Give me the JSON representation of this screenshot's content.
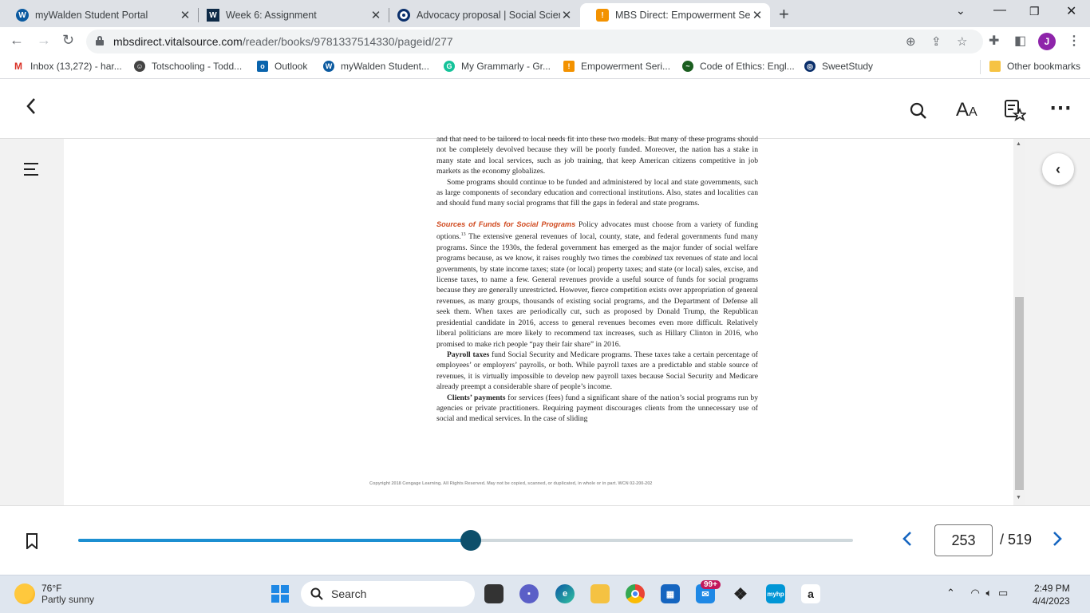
{
  "browser": {
    "tabs": [
      {
        "title": "myWalden Student Portal",
        "icon": "walden-icon",
        "active": false
      },
      {
        "title": "Week 6: Assignment",
        "icon": "walden-w-icon",
        "active": false
      },
      {
        "title": "Advocacy proposal | Social Scienc",
        "icon": "sweetstudy-icon",
        "active": false
      },
      {
        "title": "MBS Direct: Empowerment Series",
        "icon": "mbs-icon",
        "active": true
      }
    ],
    "url_domain": "mbsdirect.vitalsource.com",
    "url_path": "/reader/books/9781337514330/pageid/277",
    "profile_initial": "J",
    "bookmarks": [
      {
        "label": "Inbox (13,272) - har...",
        "icon": "gmail-icon"
      },
      {
        "label": "Totschooling - Todd...",
        "icon": "totschooling-icon"
      },
      {
        "label": "Outlook",
        "icon": "outlook-icon"
      },
      {
        "label": "myWalden Student...",
        "icon": "walden-icon"
      },
      {
        "label": "My Grammarly - Gr...",
        "icon": "grammarly-icon"
      },
      {
        "label": "Empowerment Seri...",
        "icon": "mbs-icon"
      },
      {
        "label": "Code of Ethics: Engl...",
        "icon": "nasw-icon"
      },
      {
        "label": "SweetStudy",
        "icon": "sweetstudy-icon"
      }
    ],
    "other_bookmarks": "Other bookmarks"
  },
  "book": {
    "para1": "and that need to be tailored to local needs fit into these two models. But many of these programs should not be completely devolved because they will be poorly funded. Moreover, the nation has a stake in many state and local services, such as job training, that keep American citizens competitive in job markets as the economy globalizes.",
    "para2": "Some programs should continue to be funded and administered by local and state governments, such as large components of secondary education and correctional institutions. Also, states and localities can and should fund many social programs that fill the gaps in federal and state programs.",
    "section_heading": "Sources of Funds for Social Programs",
    "para3_a": " Policy advocates must choose from a variety of funding options.",
    "para3_footnote": "13",
    "para3_b": " The extensive general revenues of local, county, state, and federal governments fund many programs. Since the 1930s, the federal government has emerged as the major funder of social welfare programs because, as we know, it raises roughly two times the ",
    "para3_emph": "combined",
    "para3_c": " tax revenues of state and local governments, by state income taxes; state (or local) property taxes; and state (or local) sales, excise, and license taxes, to name a few. General revenues provide a useful source of funds for social programs because they are generally unrestricted. However, fierce competition exists over appropriation of general revenues, as many groups, thousands of existing social programs, and the Department of Defense all seek them. When taxes are periodically cut, such as proposed by Donald Trump, the Republican presidential candidate in 2016, access to general revenues becomes even more difficult. Relatively liberal politicians are more likely to recommend tax increases, such as Hillary Clinton in 2016, who promised to make rich people “pay their fair share” in 2016.",
    "para4_bold": "Payroll taxes",
    "para4": " fund Social Security and Medicare programs. These taxes take a certain percentage of employees’ or employers’ payrolls, or both. While payroll taxes are a predictable and stable source of revenues, it is virtually impossible to develop new payroll taxes because Social Security and Medicare already preempt a considerable share of people’s income.",
    "para5_bold": "Clients’ payments",
    "para5": " for services (fees) fund a significant share of the nation’s social programs run by agencies or private practitioners. Requiring payment discourages clients from the unnecessary use of social and medical services. In the case of sliding",
    "copyright": "Copyright 2018 Cengage Learning. All Rights Reserved. May not be copied, scanned, or duplicated, in whole or in part.  WCN 02-200-202"
  },
  "reader": {
    "current_page": "253",
    "total_pages": "/ 519",
    "progress_fraction": 0.507
  },
  "taskbar": {
    "temperature": "76°F",
    "weather": "Partly sunny",
    "search_placeholder": "Search",
    "mail_badge": "99+",
    "time": "2:49 PM",
    "date": "4/4/2023"
  },
  "colors": {
    "accent": "#1c8fd1",
    "knob": "#0d4f6b",
    "heading": "#d04a1f",
    "nav_arrow": "#1565c0"
  }
}
